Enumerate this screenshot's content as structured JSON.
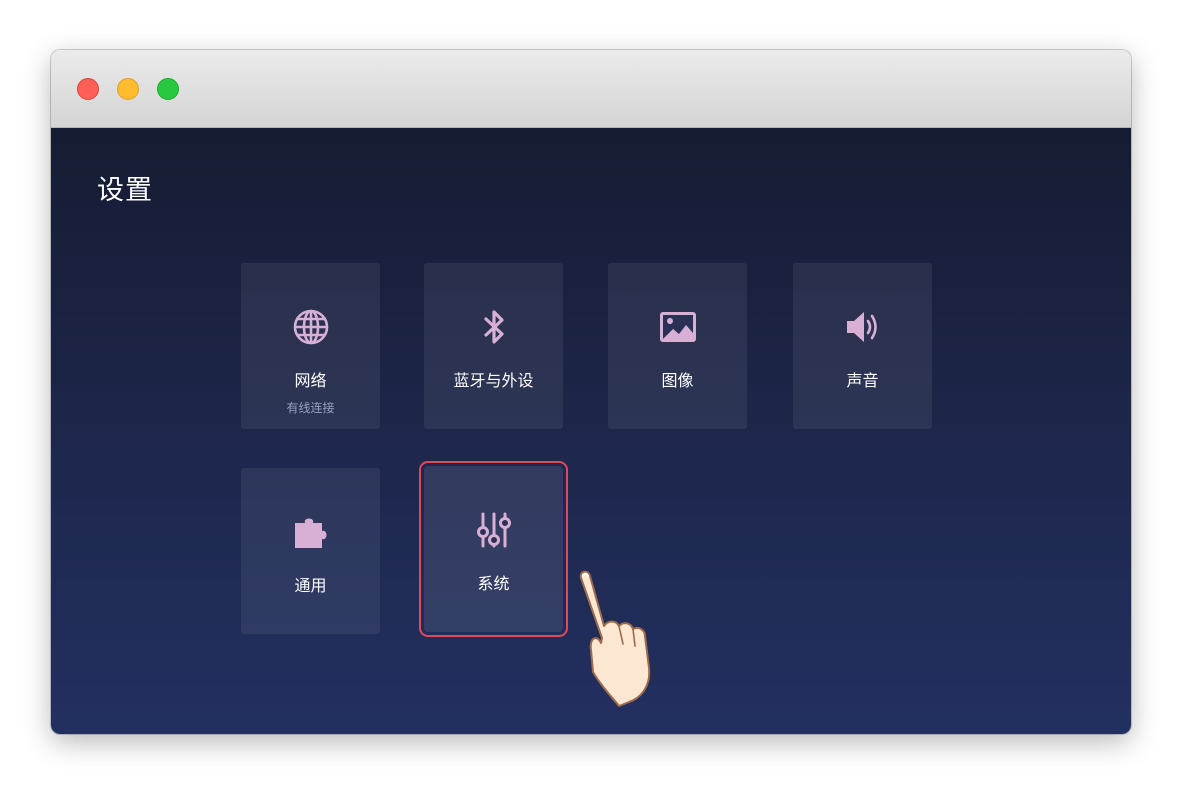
{
  "window": {
    "controls": [
      "close",
      "minimize",
      "maximize"
    ]
  },
  "page": {
    "title": "设置"
  },
  "tiles": [
    {
      "label": "网络",
      "sublabel": "有线连接",
      "icon": "globe-icon"
    },
    {
      "label": "蓝牙与外设",
      "icon": "bluetooth-icon"
    },
    {
      "label": "图像",
      "icon": "image-icon"
    },
    {
      "label": "声音",
      "icon": "speaker-icon"
    },
    {
      "label": "通用",
      "icon": "puzzle-icon"
    },
    {
      "label": "系统",
      "icon": "sliders-icon",
      "selected": true
    }
  ],
  "colors": {
    "icon": "#d8b0d6",
    "selection_outline": "#e04a57",
    "background_top": "#161c33",
    "background_bottom": "#223061"
  }
}
